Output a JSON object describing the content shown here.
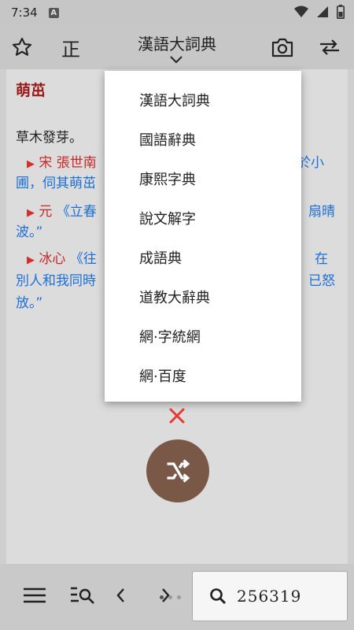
{
  "status_bar": {
    "time": "7:34",
    "notification_letter": "A",
    "icons": [
      "wifi-icon",
      "signal-icon",
      "battery-icon"
    ]
  },
  "app_bar": {
    "favorite_icon": "star-outline-icon",
    "script_toggle_label": "正",
    "current_dictionary": "漢語大詞典",
    "camera_icon": "camera-icon",
    "swap_icon": "swap-icon"
  },
  "entry": {
    "headword": "萌茁",
    "definition": "草木發芽。",
    "examples": [
      {
        "source": "宋 張世南",
        "tail": "於小",
        "line2": "圃，伺其萌茁"
      },
      {
        "source": "元",
        "quote_start": "《立春",
        "tail": "扇晴",
        "line2": "波。”"
      },
      {
        "source": "冰心",
        "quote_start": "《往",
        "tail": "在",
        "line2": "別人和我同時",
        "tail2": "已怒",
        "line3": "放。”"
      }
    ]
  },
  "dictionary_menu": {
    "items": [
      "漢語大詞典",
      "國語辭典",
      "康熙字典",
      "說文解字",
      "成語典",
      "道教大辭典",
      "網·字統網",
      "網·百度"
    ]
  },
  "actions": {
    "close_icon": "close-icon",
    "random_icon": "shuffle-icon"
  },
  "bottom_bar": {
    "menu_icon": "menu-icon",
    "search_list_icon": "search-list-icon",
    "prev_icon": "chevron-left-icon",
    "next_icon": "chevron-right-icon",
    "search_value": "256319",
    "search_icon": "search-icon"
  },
  "colors": {
    "headword": "#9a1a1a",
    "quote": "#1d6fd6",
    "source": "#c62828",
    "fab": "#7a5848",
    "close": "#e53935"
  }
}
